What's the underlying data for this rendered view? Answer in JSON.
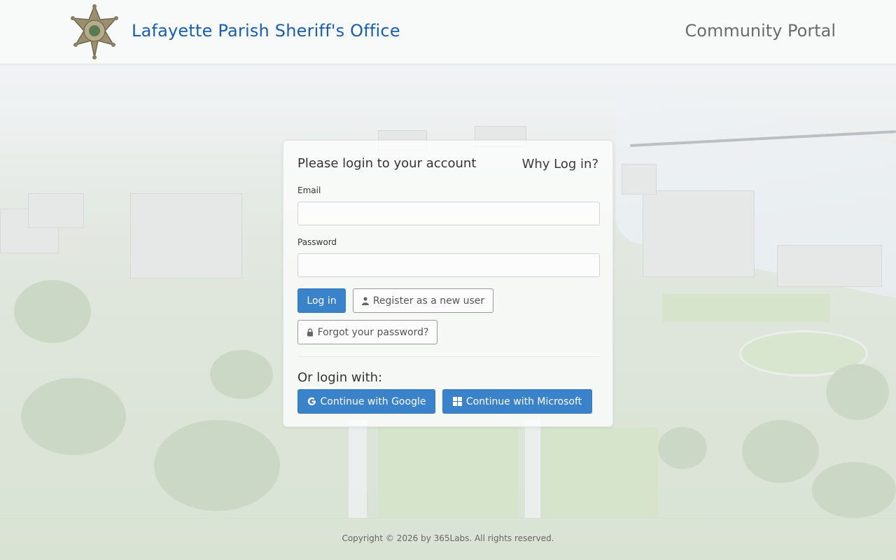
{
  "header": {
    "site_title": "Lafayette Parish Sheriff's Office",
    "portal_title": "Community Portal",
    "logo_icon": "sheriff-star-badge-icon"
  },
  "login": {
    "title": "Please login to your account",
    "why_link": "Why Log in?",
    "email_label": "Email",
    "email_value": "",
    "password_label": "Password",
    "password_value": "",
    "login_button": "Log in",
    "register_button": "Register as a new user",
    "register_icon": "user-icon",
    "forgot_button": "Forgot your password?",
    "forgot_icon": "lock-icon",
    "or_login_with": "Or login with:",
    "google_button": "Continue with Google",
    "google_icon": "google-g-icon",
    "microsoft_button": "Continue with Microsoft",
    "microsoft_icon": "windows-icon"
  },
  "footer": {
    "copyright": "Copyright © 2026 by 365Labs. All rights reserved."
  },
  "colors": {
    "brand_blue": "#1a5fae",
    "primary_button": "#3a82c9",
    "muted_text": "#6b6b6b"
  }
}
